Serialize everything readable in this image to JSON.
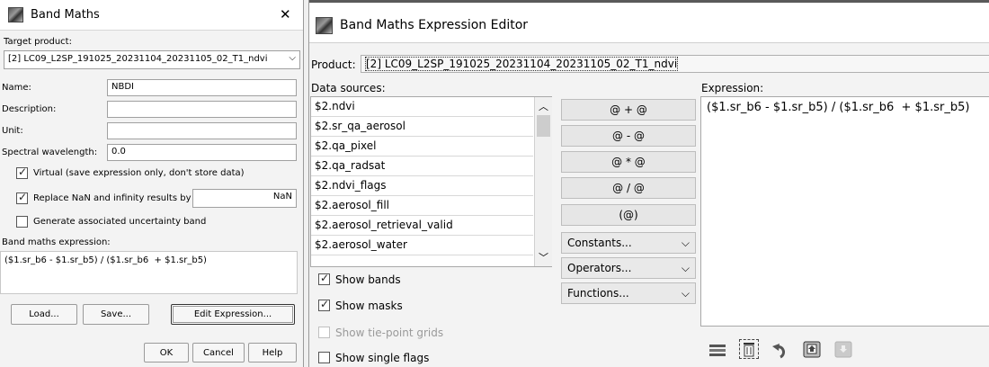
{
  "band_maths": {
    "title": "Band Maths",
    "close_glyph": "✕",
    "target_product_label": "Target product:",
    "target_product_value": "[2] LC09_L2SP_191025_20231104_20231105_02_T1_ndvi",
    "name_label": "Name:",
    "name_value": "NBDI",
    "description_label": "Description:",
    "description_value": "",
    "unit_label": "Unit:",
    "unit_value": "",
    "spectral_label": "Spectral wavelength:",
    "spectral_value": "0.0",
    "virtual_label": "Virtual (save expression only, don't store data)",
    "replace_nan_label": "Replace NaN and infinity results by",
    "replace_nan_value": "NaN",
    "uncertainty_label": "Generate associated uncertainty band",
    "expr_label": "Band maths expression:",
    "expression": "($1.sr_b6 - $1.sr_b5) / ($1.sr_b6  + $1.sr_b5)",
    "load_label": "Load...",
    "save_label": "Save...",
    "edit_expr_label": "Edit Expression...",
    "ok_label": "OK",
    "cancel_label": "Cancel",
    "help_label": "Help"
  },
  "editor": {
    "title": "Band Maths Expression Editor",
    "product_label": "Product:",
    "product_value": "[2] LC09_L2SP_191025_20231104_20231105_02_T1_ndvi",
    "data_sources_label": "Data sources:",
    "sources": [
      "$2.ndvi",
      "$2.sr_qa_aerosol",
      "$2.qa_pixel",
      "$2.qa_radsat",
      "$2.ndvi_flags",
      "$2.aerosol_fill",
      "$2.aerosol_retrieval_valid",
      "$2.aerosol_water"
    ],
    "operators": [
      "@ + @",
      "@ - @",
      "@ * @",
      "@ / @",
      "(@)"
    ],
    "constants_label": "Constants...",
    "operators_label": "Operators...",
    "functions_label": "Functions...",
    "show_bands_label": "Show bands",
    "show_masks_label": "Show masks",
    "show_tiepoint_label": "Show tie-point grids",
    "show_single_flags_label": "Show single flags",
    "expression_label": "Expression:",
    "expression": "($1.sr_b6 - $1.sr_b5) / ($1.sr_b6  + $1.sr_b5)"
  }
}
